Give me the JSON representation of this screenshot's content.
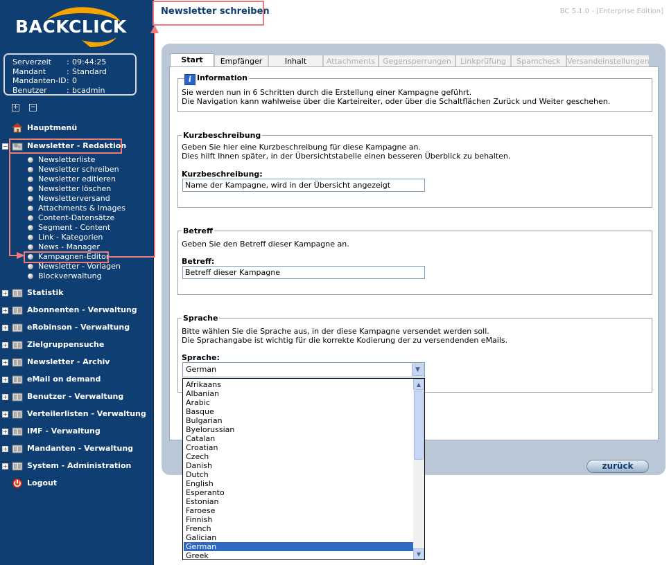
{
  "app": {
    "logo_text": "BACKCLICK",
    "page_title": "Newsletter schreiben",
    "version": "BC 5.1.0 - [Enterprise Edition]"
  },
  "server_info": [
    {
      "label": "Serverzeit",
      "value": "09:44:25"
    },
    {
      "label": "Mandant",
      "value": "Standard"
    },
    {
      "label": "Mandanten-ID",
      "value": "0"
    },
    {
      "label": "Benutzer",
      "value": "bcadmin"
    }
  ],
  "server_info_sep": ":",
  "tree_buttons": {
    "expand": "+",
    "collapse": "−"
  },
  "sidebar": {
    "hauptmenue": "Hauptmenü",
    "redaktion": "Newsletter - Redaktion",
    "redaktion_items": [
      "Newsletterliste",
      "Newsletter schreiben",
      "Newsletter editieren",
      "Newsletter löschen",
      "Newsletterversand",
      "Attachments & Images",
      "Content-Datensätze",
      "Segment - Content",
      "Link - Kategorien",
      "News - Manager",
      "Kampagnen-Editor",
      "Newsletter - Vorlagen",
      "Blockverwaltung"
    ],
    "sections": [
      "Statistik",
      "Abonnenten - Verwaltung",
      "eRobinson - Verwaltung",
      "Zielgruppensuche",
      "Newsletter - Archiv",
      "eMail on demand",
      "Benutzer - Verwaltung",
      "Verteilerlisten - Verwaltung",
      "IMF - Verwaltung",
      "Mandanten - Verwaltung",
      "System - Administration"
    ],
    "logout": "Logout"
  },
  "tabs": [
    {
      "label": "Start",
      "state": "active"
    },
    {
      "label": "Empfänger",
      "state": "enabled"
    },
    {
      "label": "Inhalt",
      "state": "enabled"
    },
    {
      "label": "Attachments",
      "state": "disabled"
    },
    {
      "label": "Gegensperrungen",
      "state": "disabled"
    },
    {
      "label": "Linkprüfung",
      "state": "disabled"
    },
    {
      "label": "Spamcheck",
      "state": "disabled"
    },
    {
      "label": "Versandeinstellungen",
      "state": "disabled"
    }
  ],
  "information": {
    "icon_glyph": "i",
    "title": "Information",
    "line1": "Sie werden nun in 6 Schritten durch die Erstellung einer Kampagne geführt.",
    "line2": "Die Navigation kann wahlweise über die Karteireiter, oder über die Schaltflächen Zurück und Weiter geschehen."
  },
  "kurzbeschreibung": {
    "title": "Kurzbeschreibung",
    "line1": "Geben Sie hier eine Kurzbeschreibung für diese Kampagne an.",
    "line2": "Dies hilft Ihnen später, in der Übersichtstabelle einen besseren Überblick zu behalten.",
    "label": "Kurzbeschreibung:",
    "value": "Name der Kampagne, wird in der Übersicht angezeigt"
  },
  "betreff": {
    "title": "Betreff",
    "line1": "Geben Sie den Betreff dieser Kampagne an.",
    "label": "Betreff:",
    "value": "Betreff dieser Kampagne"
  },
  "sprache": {
    "title": "Sprache",
    "line1": "Bitte wählen Sie die Sprache aus, in der diese Kampagne versendet werden soll.",
    "line2": "Die Sprachangabe ist wichtig für die korrekte Kodierung der zu versendenden eMails.",
    "label": "Sprache:",
    "selected": "German",
    "options": [
      "Afrikaans",
      "Albanian",
      "Arabic",
      "Basque",
      "Bulgarian",
      "Byelorussian",
      "Catalan",
      "Croatian",
      "Czech",
      "Danish",
      "Dutch",
      "English",
      "Esperanto",
      "Estonian",
      "Faroese",
      "Finnish",
      "French",
      "Galician",
      "German",
      "Greek"
    ]
  },
  "buttons": {
    "zurueck": "zurück"
  },
  "colors": {
    "sidebar_bg": "#0f3f72",
    "accent": "#0f3f72",
    "highlight": "#f07a7a",
    "panel_bg": "#b9c7d6",
    "selection": "#316ac5"
  }
}
